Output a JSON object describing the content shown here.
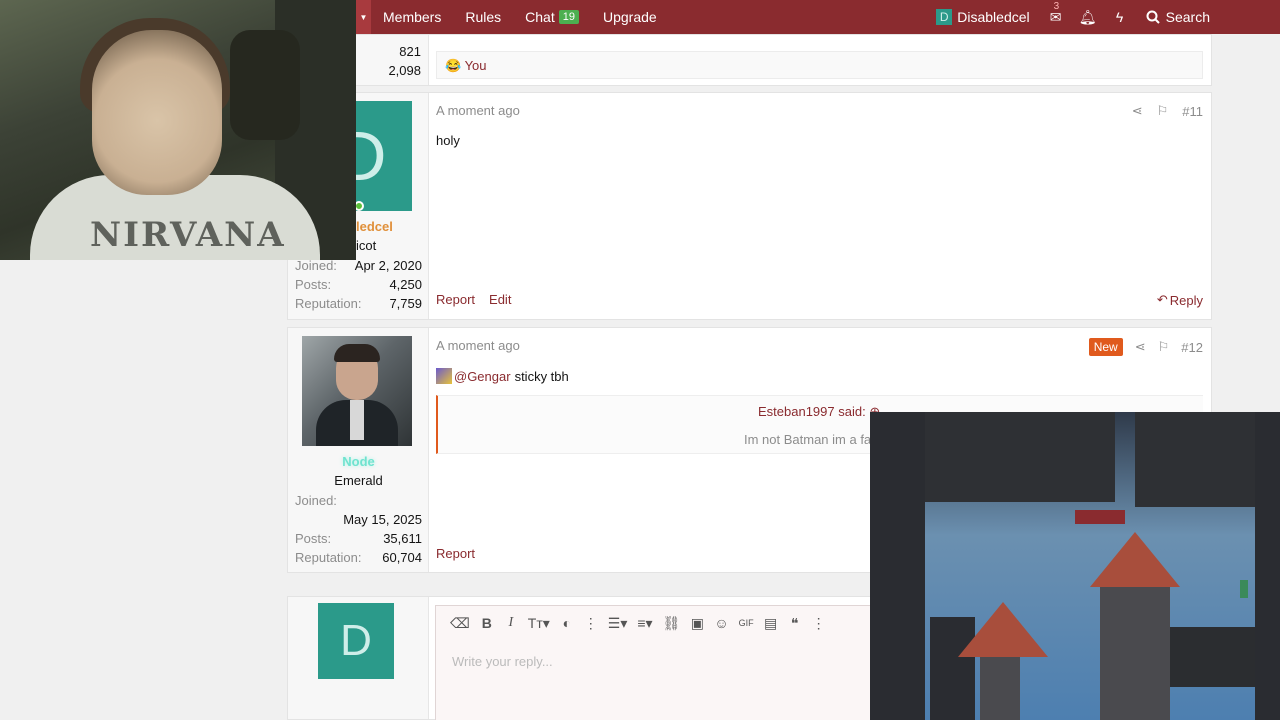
{
  "nav": {
    "items": [
      "Members",
      "Rules",
      "Chat",
      "Upgrade"
    ],
    "chat_badge": "19",
    "username": "Disabledcel",
    "avatar_letter": "D",
    "inbox_count": "3",
    "search_label": "Search"
  },
  "prev_post": {
    "stat1": "821",
    "stat2": "2,098",
    "reaction_label": "You"
  },
  "post11": {
    "time": "A moment ago",
    "number": "#11",
    "text": "holy",
    "avatar_letter": "D",
    "username_partial": "ledcel",
    "title_partial": "icot",
    "joined_label": "Joined:",
    "joined": "Apr 2, 2020",
    "posts_label": "Posts:",
    "posts": "4,250",
    "rep_label": "Reputation:",
    "rep": "7,759",
    "report": "Report",
    "edit": "Edit",
    "reply": "Reply"
  },
  "post12": {
    "time": "A moment ago",
    "new_tag": "New",
    "number": "#12",
    "mention": "@Gengar",
    "text": "sticky tbh",
    "quote_author": "Esteban1997 said:",
    "quote_text": "Im not Batman im a fa",
    "username": "Node",
    "title": "Emerald",
    "joined_label": "Joined:",
    "joined": "May 15, 2025",
    "posts_label": "Posts:",
    "posts": "35,611",
    "rep_label": "Reputation:",
    "rep": "60,704",
    "report": "Report"
  },
  "editor": {
    "avatar_letter": "D",
    "placeholder": "Write your reply..."
  },
  "webcam": {
    "shirt_text": "NIRVANA"
  },
  "colors": {
    "nav": "#8a2b2f",
    "avatar": "#2b9a8a",
    "new_tag": "#e05a1d",
    "link": "#8a2b2f"
  }
}
